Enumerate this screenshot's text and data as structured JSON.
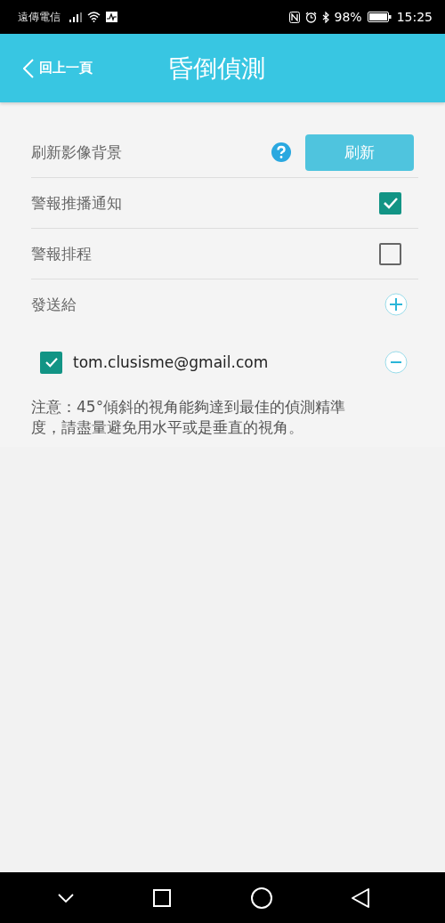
{
  "status_bar": {
    "carrier": "遠傳電信",
    "battery": "98%",
    "time": "15:25"
  },
  "header": {
    "back": "回上一頁",
    "title": "昏倒偵測"
  },
  "settings": [
    {
      "kind": "button",
      "label": "刷新影像背景",
      "button": "刷新"
    },
    {
      "kind": "checkbox",
      "label": "警報推播通知",
      "checked": true
    },
    {
      "kind": "checkbox",
      "label": "警報排程",
      "checked": false
    },
    {
      "kind": "add",
      "label": "發送給"
    }
  ],
  "recipients": [
    {
      "email": "tom.clusisme@gmail.com",
      "checked": true
    }
  ],
  "note": "注意：45°傾斜的視角能夠達到最佳的偵測精準度，請盡量避免用水平或是垂直的視角。"
}
